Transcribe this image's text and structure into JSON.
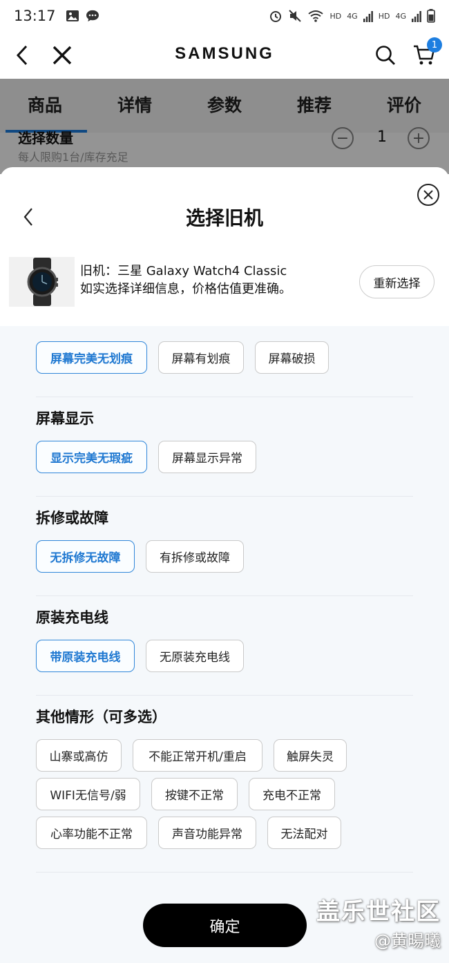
{
  "status_bar": {
    "time": "13:17",
    "indicators": [
      "HD",
      "4G",
      "HD",
      "4G"
    ]
  },
  "header": {
    "brand": "SAMSUNG",
    "cart_count": "1"
  },
  "tabs": [
    {
      "label": "商品"
    },
    {
      "label": "详情"
    },
    {
      "label": "参数"
    },
    {
      "label": "推荐"
    },
    {
      "label": "评价"
    }
  ],
  "behind": {
    "qty_title": "选择数量",
    "limit": "每人限购1台/库存充足",
    "qty": "1",
    "minus": "−",
    "plus": "+"
  },
  "sheet": {
    "title": "选择旧机",
    "device": {
      "name": "旧机：三星 Galaxy Watch4 Classic",
      "hint": "如实选择详细信息，价格估值更准确。"
    },
    "reselect": "重新选择",
    "screen_condition": {
      "options": [
        "屏幕完美无划痕",
        "屏幕有划痕",
        "屏幕破损"
      ]
    },
    "screen_display": {
      "label": "屏幕显示",
      "options": [
        "显示完美无瑕疵",
        "屏幕显示异常"
      ]
    },
    "repair": {
      "label": "拆修或故障",
      "options": [
        "无拆修无故障",
        "有拆修或故障"
      ]
    },
    "charger": {
      "label": "原装充电线",
      "options": [
        "带原装充电线",
        "无原装充电线"
      ]
    },
    "other": {
      "label": "其他情形（可多选）",
      "options": [
        "山寨或高仿",
        "不能正常开机/重启",
        "触屏失灵",
        "WIFI无信号/弱",
        "按键不正常",
        "充电不正常",
        "心率功能不正常",
        "声音功能异常",
        "无法配对"
      ]
    },
    "confirm": "确定"
  },
  "watermark": {
    "line1": "盖乐世社区",
    "line2": "@黄暘曦"
  },
  "colors": {
    "accent": "#1f78d1",
    "badge": "#1d7ee0",
    "confirm_bg": "#000000"
  }
}
